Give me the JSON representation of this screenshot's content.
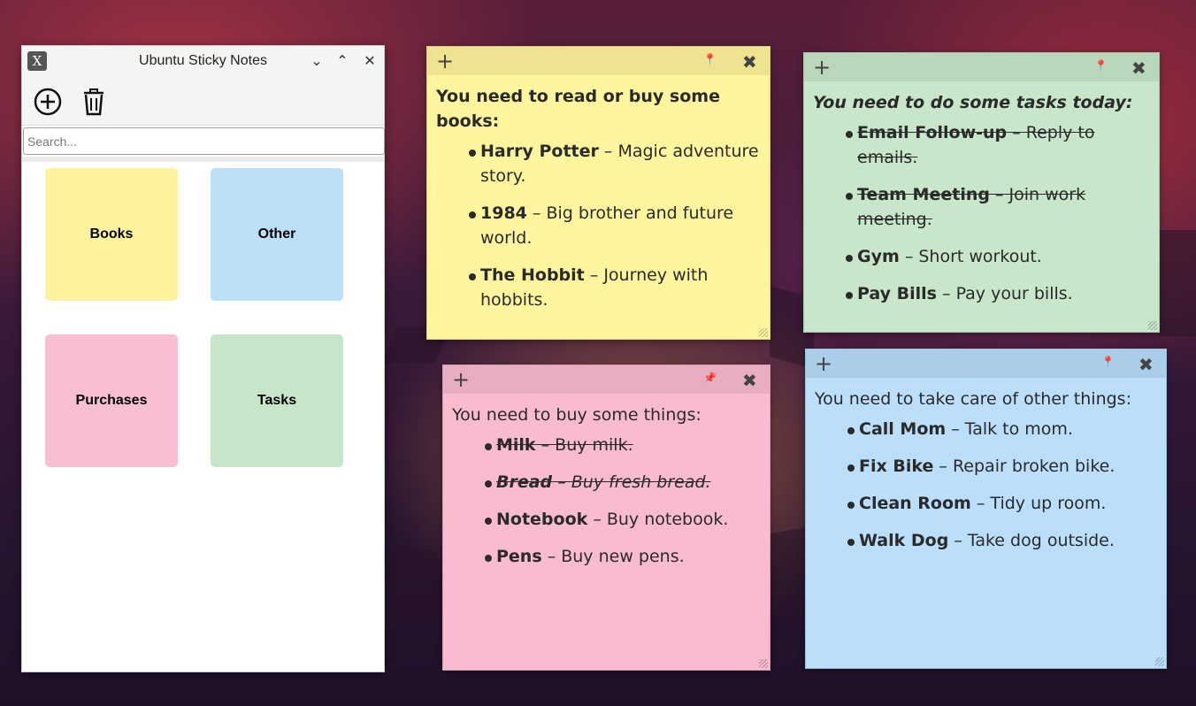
{
  "window": {
    "title": "Ubuntu Sticky Notes",
    "app_icon": "X",
    "controls": {
      "minimize": "⌄",
      "maximize": "⌃",
      "close": "✕"
    },
    "toolbar": {
      "add_icon": "add-circle-icon",
      "delete_icon": "trash-icon"
    },
    "search": {
      "placeholder": "Search...",
      "value": ""
    },
    "tiles": [
      {
        "label": "Books",
        "color": "#fdf29e"
      },
      {
        "label": "Other",
        "color": "#bcdff8"
      },
      {
        "label": "Purchases",
        "color": "#f8bed3"
      },
      {
        "label": "Tasks",
        "color": "#c7e6c9"
      }
    ]
  },
  "notes": {
    "books": {
      "color": "#fef59e",
      "bar_color": "#efe392",
      "add": "+",
      "pin": "📍",
      "close": "✖",
      "heading": "You need to read or buy some books:",
      "items": [
        {
          "title": "Harry Potter",
          "desc": " – Magic adventure story."
        },
        {
          "title": "1984",
          "desc": " – Big brother and future world."
        },
        {
          "title": "The Hobbit",
          "desc": " – Journey with hobbits."
        }
      ]
    },
    "tasks": {
      "color": "#c8e6c9",
      "bar_color": "#bad6bb",
      "add": "+",
      "pin": "📍",
      "close": "✖",
      "heading": "You need to do some tasks today:",
      "items": [
        {
          "title": "Email Follow-up",
          "desc": " – Reply to emails."
        },
        {
          "title": "Team Meeting",
          "desc": " – Join work meeting."
        },
        {
          "title": "Gym",
          "desc": " – Short workout."
        },
        {
          "title": "Pay Bills",
          "desc": " – Pay your bills."
        }
      ]
    },
    "purchases": {
      "color": "#f8bbd0",
      "bar_color": "#e9adc2",
      "add": "+",
      "pin": "📌",
      "close": "✖",
      "heading": "You need to buy some things:",
      "items": [
        {
          "title": "Milk",
          "desc": " – Buy milk."
        },
        {
          "title": "Bread",
          "desc": " – Buy fresh bread."
        },
        {
          "title": "Notebook",
          "desc": " – Buy notebook."
        },
        {
          "title": "Pens",
          "desc": " – Buy new pens."
        }
      ]
    },
    "other": {
      "color": "#bbdefb",
      "bar_color": "#aacde9",
      "add": "+",
      "pin": "📍",
      "close": "✖",
      "heading": "You need to take care of other things:",
      "items": [
        {
          "title": "Call Mom",
          "desc": " – Talk to mom."
        },
        {
          "title": "Fix Bike",
          "desc": " – Repair broken bike."
        },
        {
          "title": "Clean Room",
          "desc": " – Tidy up room."
        },
        {
          "title": "Walk Dog",
          "desc": " – Take dog outside."
        }
      ]
    }
  }
}
